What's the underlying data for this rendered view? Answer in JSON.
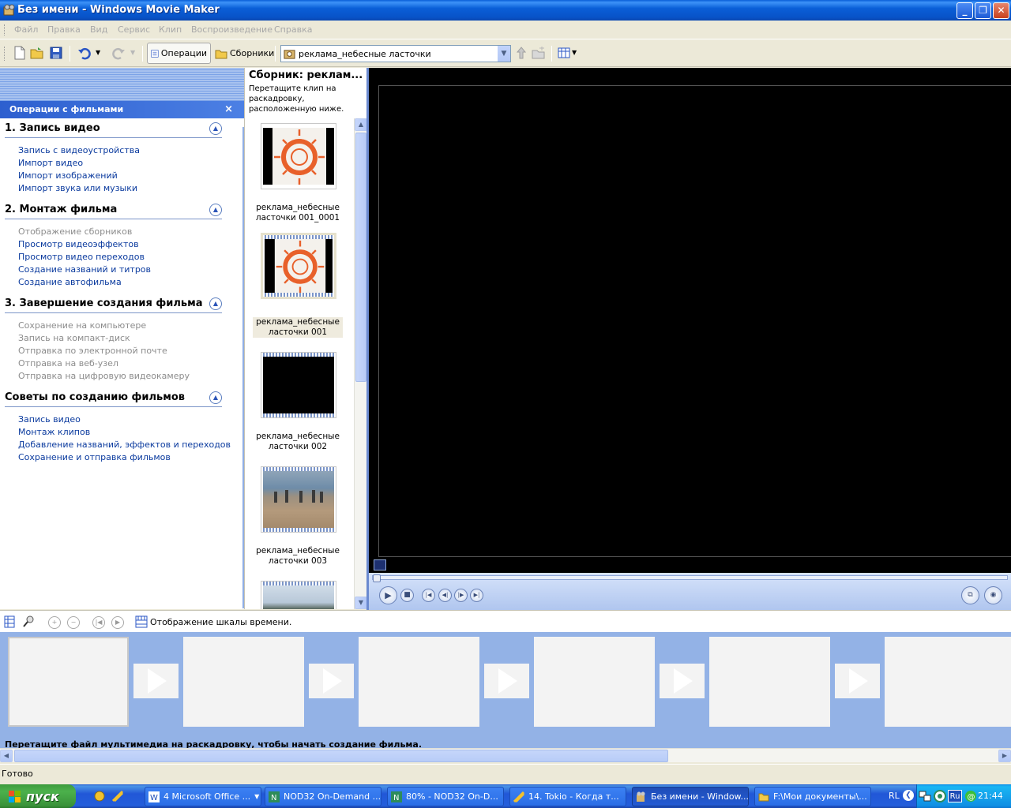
{
  "window": {
    "title": "Без имени - Windows Movie Maker",
    "minimize_icon": "minimize-icon",
    "maximize_icon": "restore-icon",
    "close_icon": "close-icon"
  },
  "menu": [
    "Файл",
    "Правка",
    "Вид",
    "Сервис",
    "Клип",
    "Воспроизведение",
    "Справка"
  ],
  "toolbar": {
    "tasks_label": "Операции",
    "collections_label": "Сборники",
    "collection_value": "реклама_небесные ласточки"
  },
  "tasks": {
    "header": "Операции с фильмами",
    "close_glyph": "×",
    "sections": [
      {
        "title": "1. Запись видео",
        "links": [
          {
            "label": "Запись с видеоустройства",
            "enabled": true
          },
          {
            "label": "Импорт видео",
            "enabled": true
          },
          {
            "label": "Импорт изображений",
            "enabled": true
          },
          {
            "label": "Импорт звука или музыки",
            "enabled": true
          }
        ]
      },
      {
        "title": "2. Монтаж фильма",
        "links": [
          {
            "label": "Отображение сборников",
            "enabled": false
          },
          {
            "label": "Просмотр видеоэффектов",
            "enabled": true
          },
          {
            "label": "Просмотр видео переходов",
            "enabled": true
          },
          {
            "label": "Создание названий и титров",
            "enabled": true
          },
          {
            "label": "Создание автофильма",
            "enabled": true
          }
        ]
      },
      {
        "title": "3. Завершение создания фильма",
        "links": [
          {
            "label": "Сохранение на компьютере",
            "enabled": false
          },
          {
            "label": "Запись на компакт-диск",
            "enabled": false
          },
          {
            "label": "Отправка по электронной почте",
            "enabled": false
          },
          {
            "label": "Отправка на веб-узел",
            "enabled": false
          },
          {
            "label": "Отправка на цифровую видеокамеру",
            "enabled": false
          }
        ]
      },
      {
        "title": "Советы по созданию фильмов",
        "links": [
          {
            "label": "Запись видео",
            "enabled": true
          },
          {
            "label": "Монтаж клипов",
            "enabled": true
          },
          {
            "label": "Добавление названий, эффектов и переходов",
            "enabled": true
          },
          {
            "label": "Сохранение и отправка фильмов",
            "enabled": true
          }
        ]
      }
    ]
  },
  "collection": {
    "title": "Сборник: реклам...",
    "hint": "Перетащите клип на раскадровку, расположенную ниже.",
    "clips": [
      {
        "label": "реклама_небесные ласточки 001_0001",
        "thumb": "logo",
        "selected": false
      },
      {
        "label": "реклама_небесные ласточки 001",
        "thumb": "logo",
        "selected": true
      },
      {
        "label": "реклама_небесные ласточки 002",
        "thumb": "black",
        "selected": false
      },
      {
        "label": "реклама_небесные ласточки 003",
        "thumb": "beach",
        "selected": false
      },
      {
        "label": "",
        "thumb": "sea",
        "selected": false
      }
    ]
  },
  "storyboard": {
    "toggle_label": "Отображение шкалы времени.",
    "hint": "Перетащите файл мультимедиа на раскадровку, чтобы начать создание фильма.",
    "cell_count": 6
  },
  "status": "Готово",
  "taskbar": {
    "start_label": "пуск",
    "buttons": [
      {
        "label": "4 Microsoft Office ...",
        "icon": "word-icon"
      },
      {
        "label": "NOD32 On-Demand ...",
        "icon": "nod32-icon"
      },
      {
        "label": "80% - NOD32 On-D...",
        "icon": "nod32-icon"
      },
      {
        "label": "14. Tokio - Когда т...",
        "icon": "winamp-icon"
      },
      {
        "label": "Без имени - Window...",
        "icon": "movie-maker-icon"
      },
      {
        "label": "F:\\Мои документы\\...",
        "icon": "folder-icon"
      }
    ],
    "lang": "RL",
    "tray_lang": "Ru",
    "clock": "21:44"
  },
  "colors": {
    "titlebar": "#0A5FD8",
    "link": "#0A3A9E",
    "storyboard_bg": "#93B2E6",
    "start_green": "#3C9A3C"
  }
}
